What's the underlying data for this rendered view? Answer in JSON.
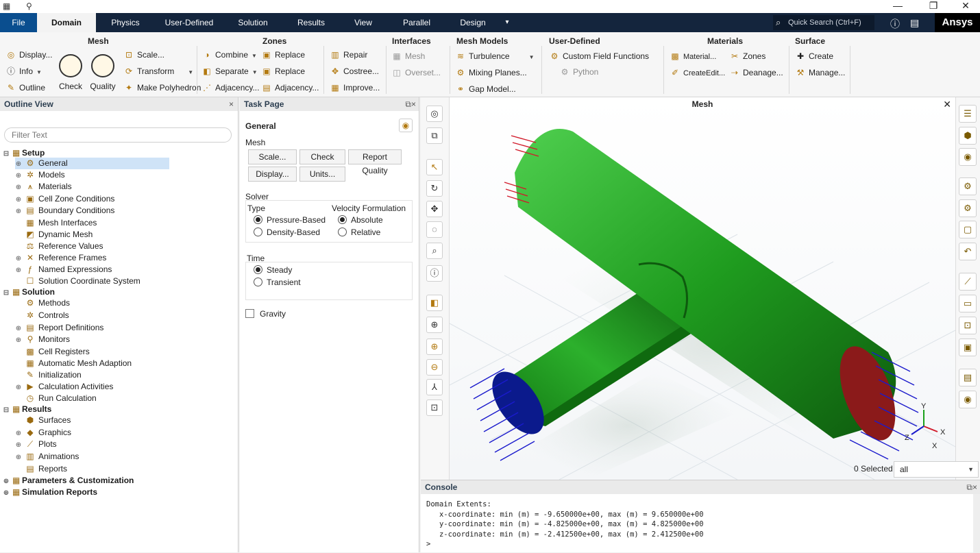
{
  "window": {
    "title_icons": [
      "app-icon",
      "pin-icon"
    ]
  },
  "menu": {
    "tabs": [
      "File",
      "Domain",
      "Physics",
      "User-Defined",
      "Solution",
      "Results",
      "View",
      "Parallel",
      "Design"
    ],
    "more": "▾",
    "search_placeholder": "Quick Search (Ctrl+F)",
    "brand": "Ansys"
  },
  "ribbon": {
    "mesh": {
      "title": "Mesh",
      "display": "Display...",
      "info": "Info",
      "outline": "Outline",
      "check": "Check",
      "quality": "Quality",
      "scale": "Scale...",
      "transform": "Transform",
      "make_polyhedron": "Make Polyhedron"
    },
    "zones": {
      "title": "Zones",
      "combine": "Combine",
      "separate": "Separate",
      "adjacency1": "Adjacency...",
      "replace1": "Replace",
      "replace2": "Replace",
      "adjacency2": "Adjacency..."
    },
    "repair": {
      "repair": "Repair",
      "costree": "Costree...",
      "improve": "Improve..."
    },
    "interfaces": {
      "title": "Interfaces",
      "mesh": "Mesh",
      "overset": "Overset..."
    },
    "mesh_models": {
      "title": "Mesh Models",
      "turbulence": "Turbulence",
      "mixing_planes": "Mixing Planes...",
      "gap_model": "Gap Model..."
    },
    "user_defined": {
      "title": "User-Defined",
      "custom_field_functions": "Custom Field Functions",
      "python": "Python"
    },
    "materials": {
      "title": "Materials",
      "material": "Material...",
      "create_edit": "CreateEdit...",
      "zones": "Zones",
      "deanage": "Deanage..."
    },
    "surface": {
      "title": "Surface",
      "create": "Create",
      "manage": "Manage..."
    }
  },
  "outline": {
    "title": "Outline View",
    "filter_placeholder": "Filter Text",
    "setup": {
      "label": "Setup",
      "items": [
        "General",
        "Models",
        "Materials",
        "Cell Zone Conditions",
        "Boundary Conditions",
        "Mesh Interfaces",
        "Dynamic Mesh",
        "Reference Values",
        "Reference Frames",
        "Named Expressions",
        "Solution Coordinate System"
      ]
    },
    "solution": {
      "label": "Solution",
      "items": [
        "Methods",
        "Controls",
        "Report Definitions",
        "Monitors",
        "Cell Registers",
        "Automatic Mesh Adaption",
        "Initialization",
        "Calculation Activities",
        "Run Calculation"
      ]
    },
    "results": {
      "label": "Results",
      "items": [
        "Surfaces",
        "Graphics",
        "Plots",
        "Animations",
        "Reports"
      ]
    },
    "parameters": "Parameters & Customization",
    "sim_reports": "Simulation Reports"
  },
  "task": {
    "title": "Task Page",
    "general": "General",
    "mesh_label": "Mesh",
    "scale_btn": "Scale...",
    "check_btn": "Check",
    "report_quality_btn": "Report Quality",
    "display_btn": "Display...",
    "units_btn": "Units...",
    "solver_label": "Solver",
    "type_label": "Type",
    "pressure_based": "Pressure-Based",
    "density_based": "Density-Based",
    "velocity_label": "Velocity Formulation",
    "absolute": "Absolute",
    "relative": "Relative",
    "time_label": "Time",
    "steady": "Steady",
    "transient": "Transient",
    "gravity": "Gravity"
  },
  "viewport": {
    "title": "Mesh",
    "selected": "0 Selected",
    "select_filter": "all"
  },
  "axes": {
    "x": "X",
    "y": "Y",
    "z": "Z"
  },
  "console": {
    "title": "Console",
    "lines": [
      "Domain Extents:",
      "   x-coordinate: min (m) = -9.650000e+00, max (m) = 9.650000e+00",
      "   y-coordinate: min (m) = -4.825000e+00, max (m) = 4.825000e+00",
      "   z-coordinate: min (m) = -2.412500e+00, max (m) = 2.412500e+00",
      ">"
    ]
  },
  "colors": {
    "pipe": "#1f9c1f",
    "inlet_arrows": "#1a1acc",
    "outlet_face": "#8b1a1a",
    "menubar": "#14253d"
  }
}
